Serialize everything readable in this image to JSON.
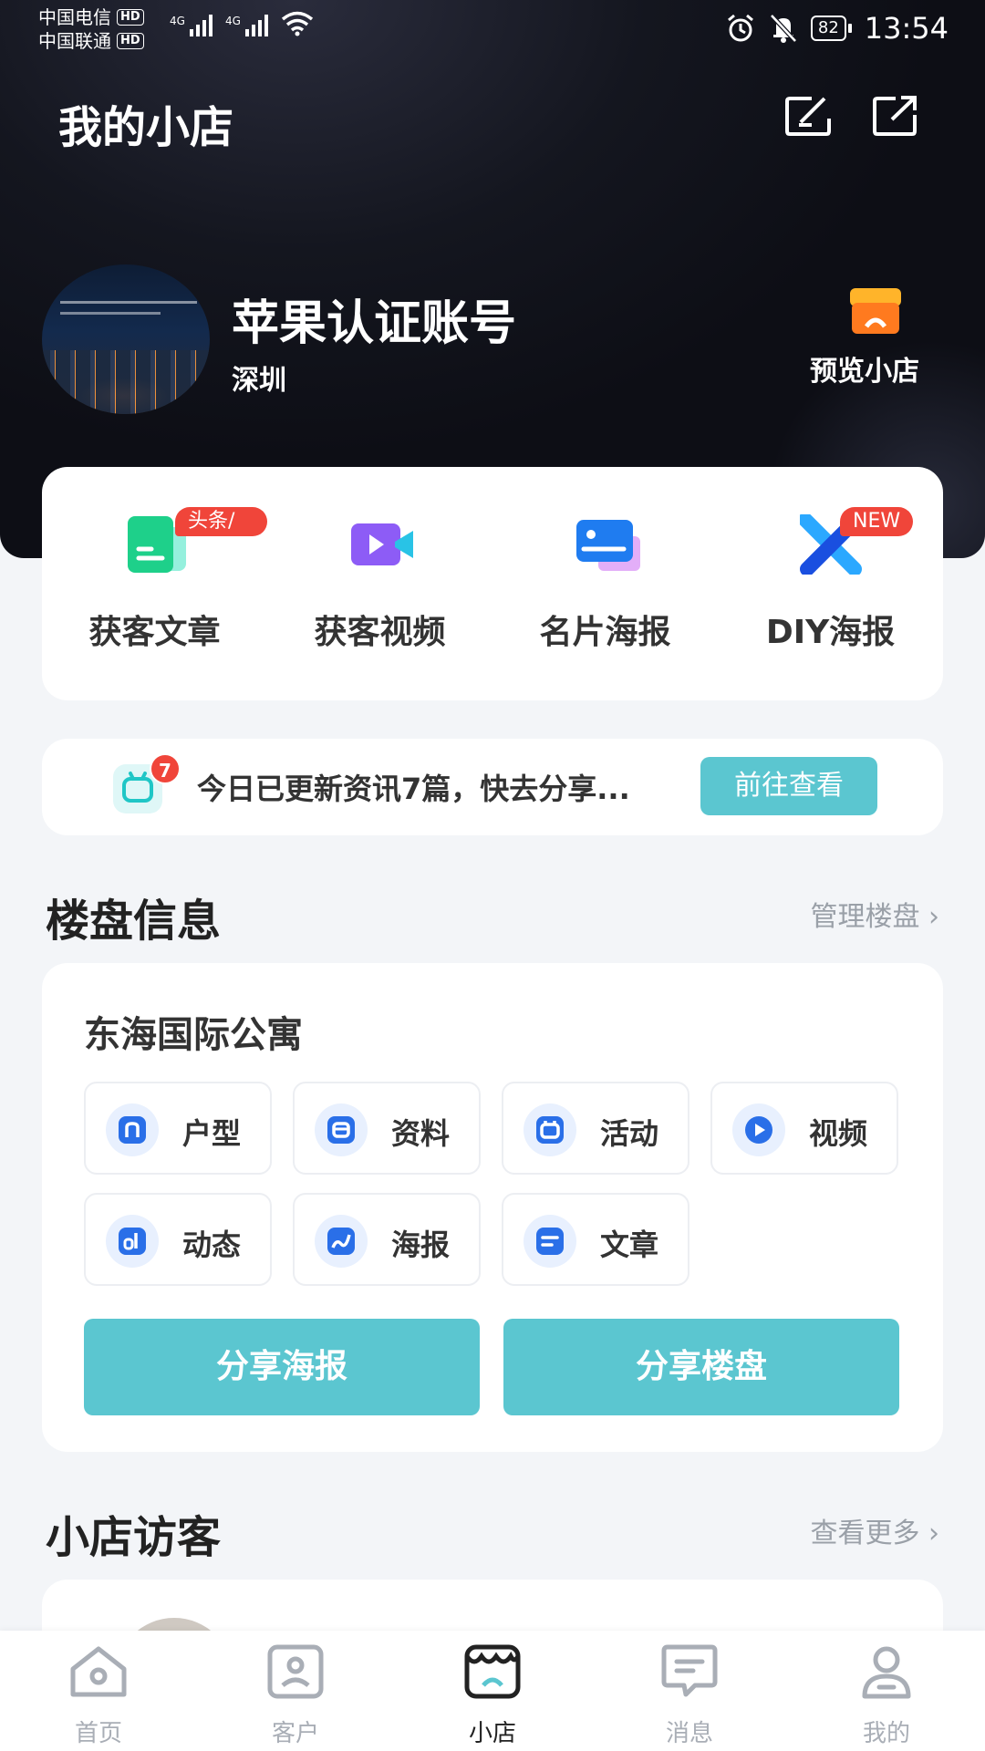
{
  "status_bar": {
    "carrier1": "中国电信",
    "carrier2": "中国联通",
    "hd": "HD",
    "network": "4G",
    "battery": "82",
    "time": "13:54"
  },
  "header": {
    "title": "我的小店",
    "icons": [
      "edit-icon",
      "share-icon"
    ]
  },
  "profile": {
    "name": "苹果认证账号",
    "city": "深圳",
    "preview_label": "预览小店"
  },
  "actions": [
    {
      "label": "获客文章",
      "tag": "头条/抖音",
      "icon": "article-icon"
    },
    {
      "label": "获客视频",
      "tag": "",
      "icon": "video-icon"
    },
    {
      "label": "名片海报",
      "tag": "",
      "icon": "card-poster-icon"
    },
    {
      "label": "DIY海报",
      "tag": "NEW",
      "icon": "diy-icon"
    }
  ],
  "news": {
    "badge": "7",
    "text": "今日已更新资讯7篇，快去分享...",
    "button": "前往查看"
  },
  "property_section": {
    "title": "楼盘信息",
    "link": "管理楼盘",
    "property_name": "东海国际公寓",
    "tiles": [
      {
        "label": "户型",
        "icon": "floorplan-icon"
      },
      {
        "label": "资料",
        "icon": "docs-icon"
      },
      {
        "label": "活动",
        "icon": "event-icon"
      },
      {
        "label": "视频",
        "icon": "play-icon"
      },
      {
        "label": "动态",
        "icon": "news-feed-icon"
      },
      {
        "label": "海报",
        "icon": "poster-icon"
      },
      {
        "label": "文章",
        "icon": "article-lines-icon"
      }
    ],
    "share_poster": "分享海报",
    "share_property": "分享楼盘"
  },
  "visitors_section": {
    "title": "小店访客",
    "link": "查看更多"
  },
  "tabbar": [
    {
      "label": "首页",
      "icon": "home-icon",
      "active": false
    },
    {
      "label": "客户",
      "icon": "customer-icon",
      "active": false
    },
    {
      "label": "小店",
      "icon": "store-icon",
      "active": true
    },
    {
      "label": "消息",
      "icon": "message-icon",
      "active": false
    },
    {
      "label": "我的",
      "icon": "profile-icon",
      "active": false
    }
  ],
  "colors": {
    "accent": "#5bc6d0",
    "tag_red": "#f0453a",
    "icon_blue": "#2a6fe8",
    "hero_dark": "#14161f"
  }
}
